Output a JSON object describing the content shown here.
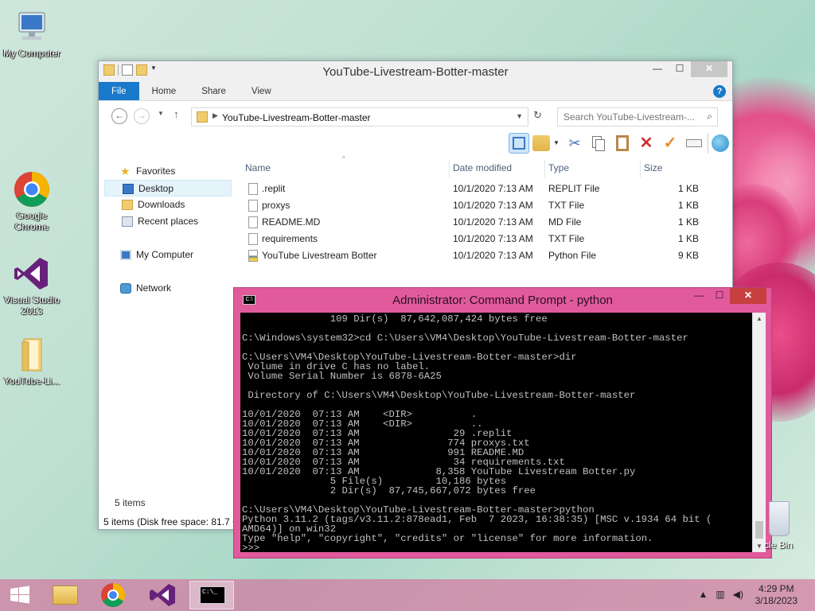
{
  "desktop": {
    "icons": [
      {
        "label": "My Computer"
      },
      {
        "label": "Google Chrome"
      },
      {
        "label": "Visual Studio 2013"
      },
      {
        "label": "YouTube-Li..."
      }
    ],
    "recycle_label": "cle Bin"
  },
  "explorer": {
    "title": "YouTube-Livestream-Botter-master",
    "tabs": [
      "File",
      "Home",
      "Share",
      "View"
    ],
    "address": "YouTube-Livestream-Botter-master",
    "search_placeholder": "Search YouTube-Livestream-...",
    "nav": {
      "favorites": "Favorites",
      "desktop": "Desktop",
      "downloads": "Downloads",
      "recent": "Recent places",
      "my_computer": "My Computer",
      "network": "Network"
    },
    "columns": {
      "name": "Name",
      "date": "Date modified",
      "type": "Type",
      "size": "Size"
    },
    "files": [
      {
        "name": ".replit",
        "date": "10/1/2020 7:13 AM",
        "type": "REPLIT File",
        "size": "1 KB"
      },
      {
        "name": "proxys",
        "date": "10/1/2020 7:13 AM",
        "type": "TXT File",
        "size": "1 KB"
      },
      {
        "name": "README.MD",
        "date": "10/1/2020 7:13 AM",
        "type": "MD File",
        "size": "1 KB"
      },
      {
        "name": "requirements",
        "date": "10/1/2020 7:13 AM",
        "type": "TXT File",
        "size": "1 KB"
      },
      {
        "name": "YouTube Livestream Botter",
        "date": "10/1/2020 7:13 AM",
        "type": "Python File",
        "size": "9 KB"
      }
    ],
    "item_count": "5 items",
    "status": "5 items (Disk free space: 81.7 G"
  },
  "cmd": {
    "title": "Administrator:  Command Prompt - python",
    "icon_text": "C:\\",
    "lines": [
      "               109 Dir(s)  87,642,087,424 bytes free",
      "",
      "C:\\Windows\\system32>cd C:\\Users\\VM4\\Desktop\\YouTube-Livestream-Botter-master",
      "",
      "C:\\Users\\VM4\\Desktop\\YouTube-Livestream-Botter-master>dir",
      " Volume in drive C has no label.",
      " Volume Serial Number is 6878-6A25",
      "",
      " Directory of C:\\Users\\VM4\\Desktop\\YouTube-Livestream-Botter-master",
      "",
      "10/01/2020  07:13 AM    <DIR>          .",
      "10/01/2020  07:13 AM    <DIR>          ..",
      "10/01/2020  07:13 AM                29 .replit",
      "10/01/2020  07:13 AM               774 proxys.txt",
      "10/01/2020  07:13 AM               991 README.MD",
      "10/01/2020  07:13 AM                34 requirements.txt",
      "10/01/2020  07:13 AM             8,358 YouTube Livestream Botter.py",
      "               5 File(s)         10,186 bytes",
      "               2 Dir(s)  87,745,667,072 bytes free",
      "",
      "C:\\Users\\VM4\\Desktop\\YouTube-Livestream-Botter-master>python",
      "Python 3.11.2 (tags/v3.11.2:878ead1, Feb  7 2023, 16:38:35) [MSC v.1934 64 bit (",
      "AMD64)] on win32",
      "Type \"help\", \"copyright\", \"credits\" or \"license\" for more information.",
      ">>> "
    ]
  },
  "taskbar": {
    "time": "4:29 PM",
    "date": "3/18/2023",
    "console_icon_text": "C:\\_"
  }
}
